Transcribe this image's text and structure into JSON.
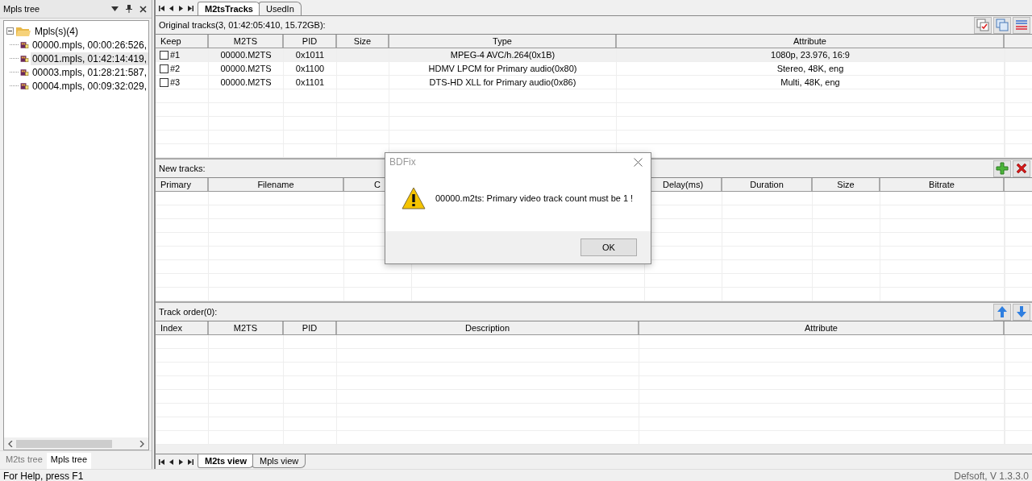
{
  "left_panel": {
    "title": "Mpls tree",
    "tree": [
      {
        "label": "Mpls(s)(4)",
        "expanded": true,
        "children": [
          {
            "label": "00000.mpls, 00:00:26:526,",
            "selected": false
          },
          {
            "label": "00001.mpls, 01:42:14:419,",
            "selected": true
          },
          {
            "label": "00003.mpls, 01:28:21:587,",
            "selected": false
          },
          {
            "label": "00004.mpls, 00:09:32:029,",
            "selected": false
          }
        ]
      }
    ],
    "tabs": [
      {
        "label": "M2ts tree",
        "selected": false
      },
      {
        "label": "Mpls tree",
        "selected": true
      }
    ]
  },
  "top_tabs": [
    {
      "label": "M2tsTracks",
      "selected": true
    },
    {
      "label": "UsedIn",
      "selected": false
    }
  ],
  "original_tracks": {
    "title": "Original tracks(3, 01:42:05:410, 15.72GB):",
    "columns": [
      "Keep",
      "M2TS",
      "PID",
      "Size",
      "Type",
      "Attribute"
    ],
    "rows": [
      {
        "checked": false,
        "selected": true,
        "number": "#1",
        "m2ts": "00000.M2TS",
        "pid": "0x1011",
        "type": "MPEG-4 AVC/h.264(0x1B)",
        "attribute": "1080p, 23.976, 16:9"
      },
      {
        "checked": false,
        "selected": false,
        "number": "#2",
        "m2ts": "00000.M2TS",
        "pid": "0x1100",
        "type": "HDMV LPCM for Primary audio(0x80)",
        "attribute": "Stereo, 48K, eng"
      },
      {
        "checked": false,
        "selected": false,
        "number": "#3",
        "m2ts": "00000.M2TS",
        "pid": "0x1101",
        "type": "DTS-HD XLL for Primary audio(0x86)",
        "attribute": "Multi, 48K, eng"
      }
    ]
  },
  "new_tracks": {
    "title": "New tracks:",
    "columns": [
      "Primary",
      "Filename",
      "C",
      "Delay(ms)",
      "Duration",
      "Size",
      "Bitrate"
    ]
  },
  "track_order": {
    "title": "Track order(0):",
    "columns": [
      "Index",
      "M2TS",
      "PID",
      "Description",
      "Attribute"
    ]
  },
  "bottom_tabs": [
    {
      "label": "M2ts view",
      "selected": true
    },
    {
      "label": "Mpls view",
      "selected": false
    }
  ],
  "dialog": {
    "title": "BDFix",
    "message": "00000.m2ts: Primary video track count must be 1 !",
    "button": "OK"
  },
  "status_bar": {
    "help": "For Help, press F1",
    "version": "Defsoft, V 1.3.3.0"
  }
}
